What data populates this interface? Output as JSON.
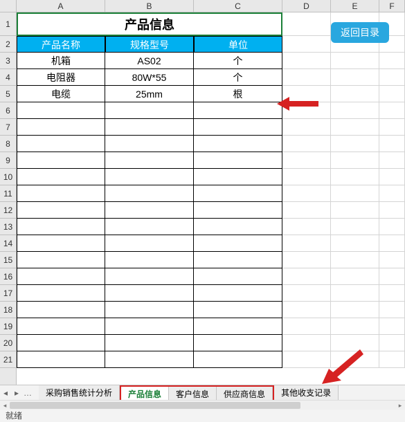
{
  "columns": [
    "A",
    "B",
    "C",
    "D",
    "E",
    "F"
  ],
  "rows": [
    "1",
    "2",
    "3",
    "4",
    "5",
    "6",
    "7",
    "8",
    "9",
    "10",
    "11",
    "12",
    "13",
    "14",
    "15",
    "16",
    "17",
    "18",
    "19",
    "20",
    "21"
  ],
  "title": "产品信息",
  "headers": [
    "产品名称",
    "规格型号",
    "单位"
  ],
  "data": [
    [
      "机箱",
      "AS02",
      "个"
    ],
    [
      "电阻器",
      "80W*55",
      "个"
    ],
    [
      "电缆",
      "25mm",
      "根"
    ]
  ],
  "return_button": "返回目录",
  "tabs": {
    "nav_prev": "◂",
    "nav_next": "▸",
    "nav_more": "…",
    "items": [
      "采购销售统计分析",
      "产品信息",
      "客户信息",
      "供应商信息",
      "其他收支记录"
    ],
    "active_index": 1,
    "highlight_start": 1,
    "highlight_end": 3
  },
  "status": "就绪",
  "colors": {
    "accent": "#00b0f0",
    "button": "#29a7df",
    "arrow": "#d62222",
    "tab_active": "#1a7f37"
  }
}
